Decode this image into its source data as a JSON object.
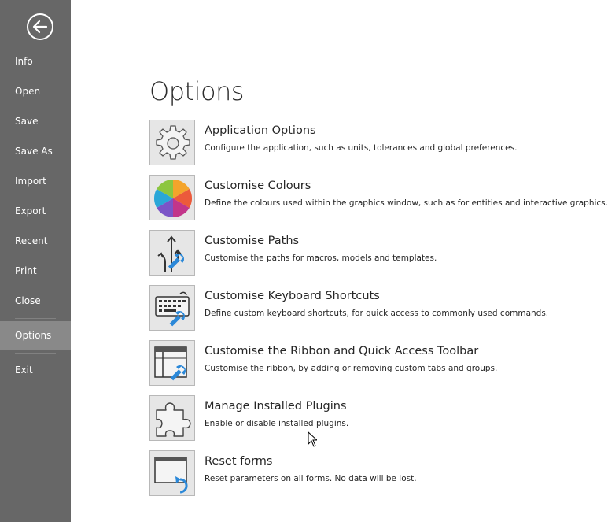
{
  "sidebar": {
    "back_icon": "back-arrow-icon",
    "items": [
      {
        "label": "Info"
      },
      {
        "label": "Open"
      },
      {
        "label": "Save"
      },
      {
        "label": "Save As"
      },
      {
        "label": "Import"
      },
      {
        "label": "Export"
      },
      {
        "label": "Recent"
      },
      {
        "label": "Print"
      },
      {
        "label": "Close"
      },
      {
        "label": "Options",
        "selected": true
      },
      {
        "label": "Exit"
      }
    ]
  },
  "main": {
    "title": "Options",
    "options": [
      {
        "title": "Application Options",
        "description": "Configure the application, such as units, tolerances and global preferences.",
        "icon": "gear-icon"
      },
      {
        "title": "Customise Colours",
        "description": "Define the colours used within the graphics window, such as for entities and interactive graphics.",
        "icon": "color-wheel-icon"
      },
      {
        "title": "Customise Paths",
        "description": "Customise the paths for macros, models and templates.",
        "icon": "paths-wrench-icon"
      },
      {
        "title": "Customise Keyboard Shortcuts",
        "description": "Define custom keyboard shortcuts, for quick access to commonly used commands.",
        "icon": "keyboard-wrench-icon"
      },
      {
        "title": "Customise the Ribbon and Quick Access Toolbar",
        "description": "Customise the ribbon, by adding or removing custom tabs and groups.",
        "icon": "ribbon-wrench-icon"
      },
      {
        "title": "Manage Installed Plugins",
        "description": "Enable or disable installed plugins.",
        "icon": "puzzle-piece-icon"
      },
      {
        "title": "Reset forms",
        "description": "Reset parameters on all forms. No data will be lost.",
        "icon": "reset-window-icon"
      }
    ]
  },
  "colors": {
    "sidebar_bg": "#676767",
    "sidebar_selected": "#898989",
    "accent_blue": "#2b88d8"
  }
}
